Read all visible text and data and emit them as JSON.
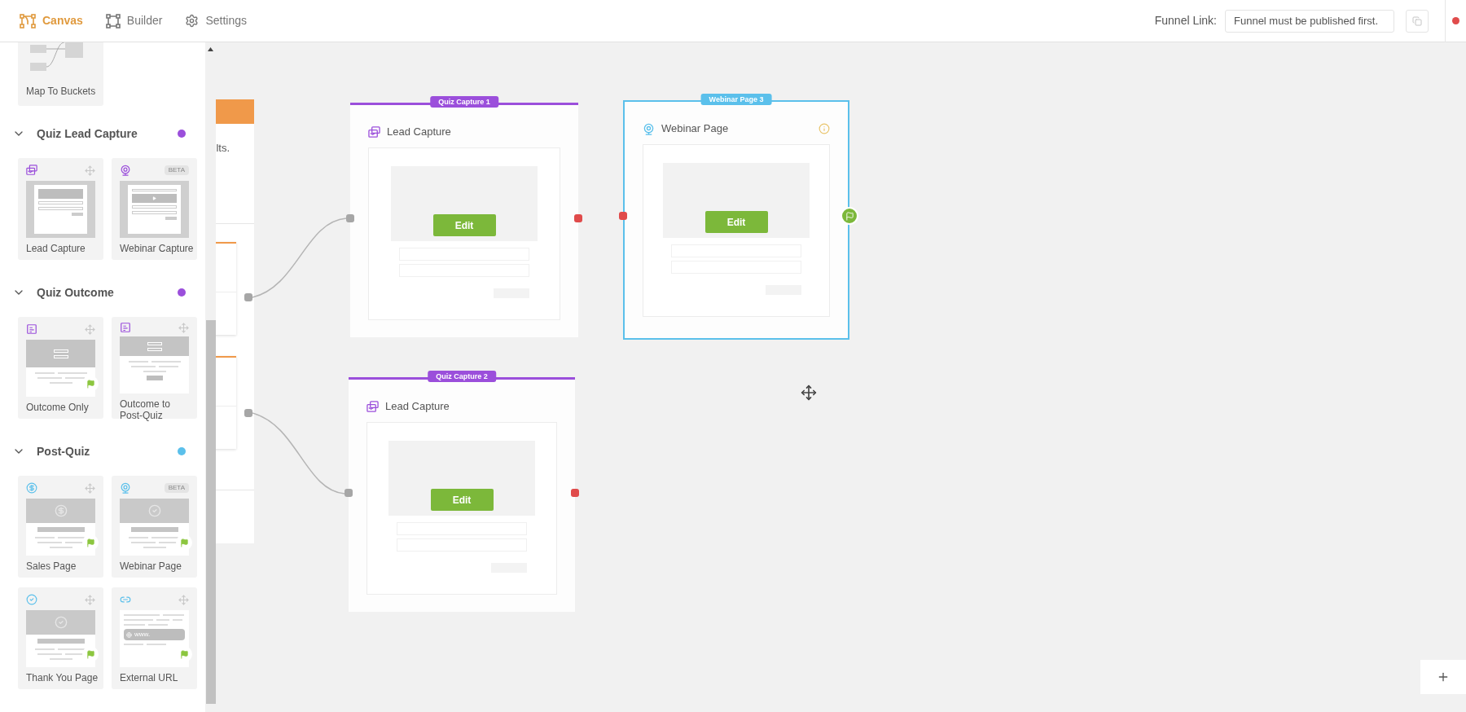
{
  "top_bar": {
    "tabs": [
      {
        "label": "Canvas",
        "kind": "canvas",
        "selected": true
      },
      {
        "label": "Builder",
        "kind": "builder",
        "selected": false
      },
      {
        "label": "Settings",
        "kind": "settings",
        "selected": false
      }
    ],
    "funnel_link": {
      "label": "Funnel Link:",
      "value": "Funnel must be published first."
    }
  },
  "sidebar": {
    "partial_template": {
      "name": "Map To Buckets",
      "kind": "buckets"
    },
    "sections": [
      {
        "title": "Quiz Lead Capture",
        "color": "#9b4fdb",
        "expanded": true,
        "templates": [
          {
            "name": "Lead Capture",
            "kind": "lead_capture",
            "flag": false
          },
          {
            "name": "Webinar Capture",
            "kind": "webinar_capture",
            "badge": "BETA",
            "flag": false
          }
        ]
      },
      {
        "title": "Quiz Outcome",
        "color": "#9b4fdb",
        "expanded": true,
        "templates": [
          {
            "name": "Outcome Only",
            "kind": "outcome_only",
            "flag": true
          },
          {
            "name": "Outcome to Post-Quiz",
            "kind": "outcome_post",
            "flag": false
          }
        ]
      },
      {
        "title": "Post-Quiz",
        "color": "#5bc0eb",
        "expanded": true,
        "templates": [
          {
            "name": "Sales Page",
            "kind": "sales",
            "flag": true
          },
          {
            "name": "Webinar Page",
            "kind": "webinar_page",
            "badge": "BETA",
            "flag": true
          },
          {
            "name": "Thank You Page",
            "kind": "thank_you",
            "flag": true
          },
          {
            "name": "External URL",
            "kind": "external_url",
            "url_text": "www.",
            "flag": true
          }
        ]
      }
    ]
  },
  "canvas": {
    "partial_node": {
      "text": "lts."
    },
    "nodes": [
      {
        "tag": "Quiz Capture 1",
        "color": "#9b4fdb",
        "kind": "lead_capture",
        "title": "Lead Capture",
        "button": "Edit",
        "selected": false,
        "info": false,
        "input_connected": true,
        "finish": false
      },
      {
        "tag": "Webinar Page 3",
        "color": "#5bc0eb",
        "kind": "webinar_page",
        "title": "Webinar Page",
        "button": "Edit",
        "selected": true,
        "info": true,
        "input_connected": false,
        "finish": true
      },
      {
        "tag": "Quiz Capture 2",
        "color": "#9b4fdb",
        "kind": "lead_capture",
        "title": "Lead Capture",
        "button": "Edit",
        "selected": false,
        "info": false,
        "input_connected": true,
        "finish": false
      }
    ]
  }
}
